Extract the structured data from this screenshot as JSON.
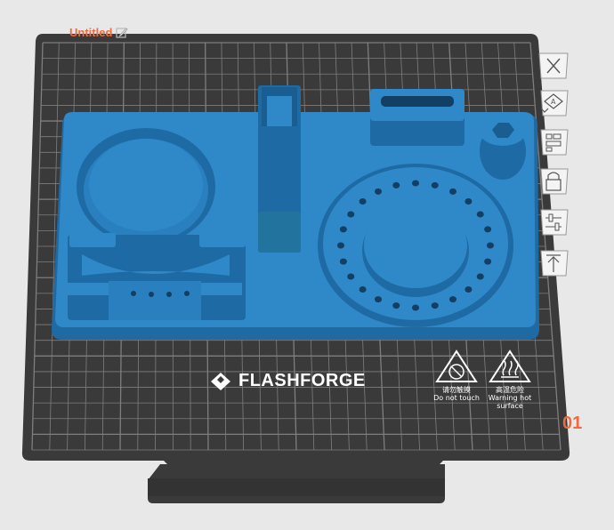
{
  "project": {
    "title": "Untitled",
    "plate_number": "01"
  },
  "bed": {
    "brand": "FLASHFORGE",
    "warnings": [
      {
        "cn": "请勿触摸",
        "en": "Do not touch"
      },
      {
        "cn": "高温危险",
        "en": "Warning hot",
        "en2": "surface"
      }
    ]
  },
  "toolbar": {
    "items": [
      {
        "name": "delete-plate-icon"
      },
      {
        "name": "auto-arrange-icon"
      },
      {
        "name": "plate-settings-icon"
      },
      {
        "name": "lock-plate-icon"
      },
      {
        "name": "plate-parameters-icon"
      },
      {
        "name": "move-plate-up-icon"
      }
    ]
  },
  "colors": {
    "background": "#e8e8e8",
    "bed": "#3a3a3a",
    "grid": "#8a8a8a",
    "model": "#2f88c8",
    "accent": "#ee6a3f"
  }
}
